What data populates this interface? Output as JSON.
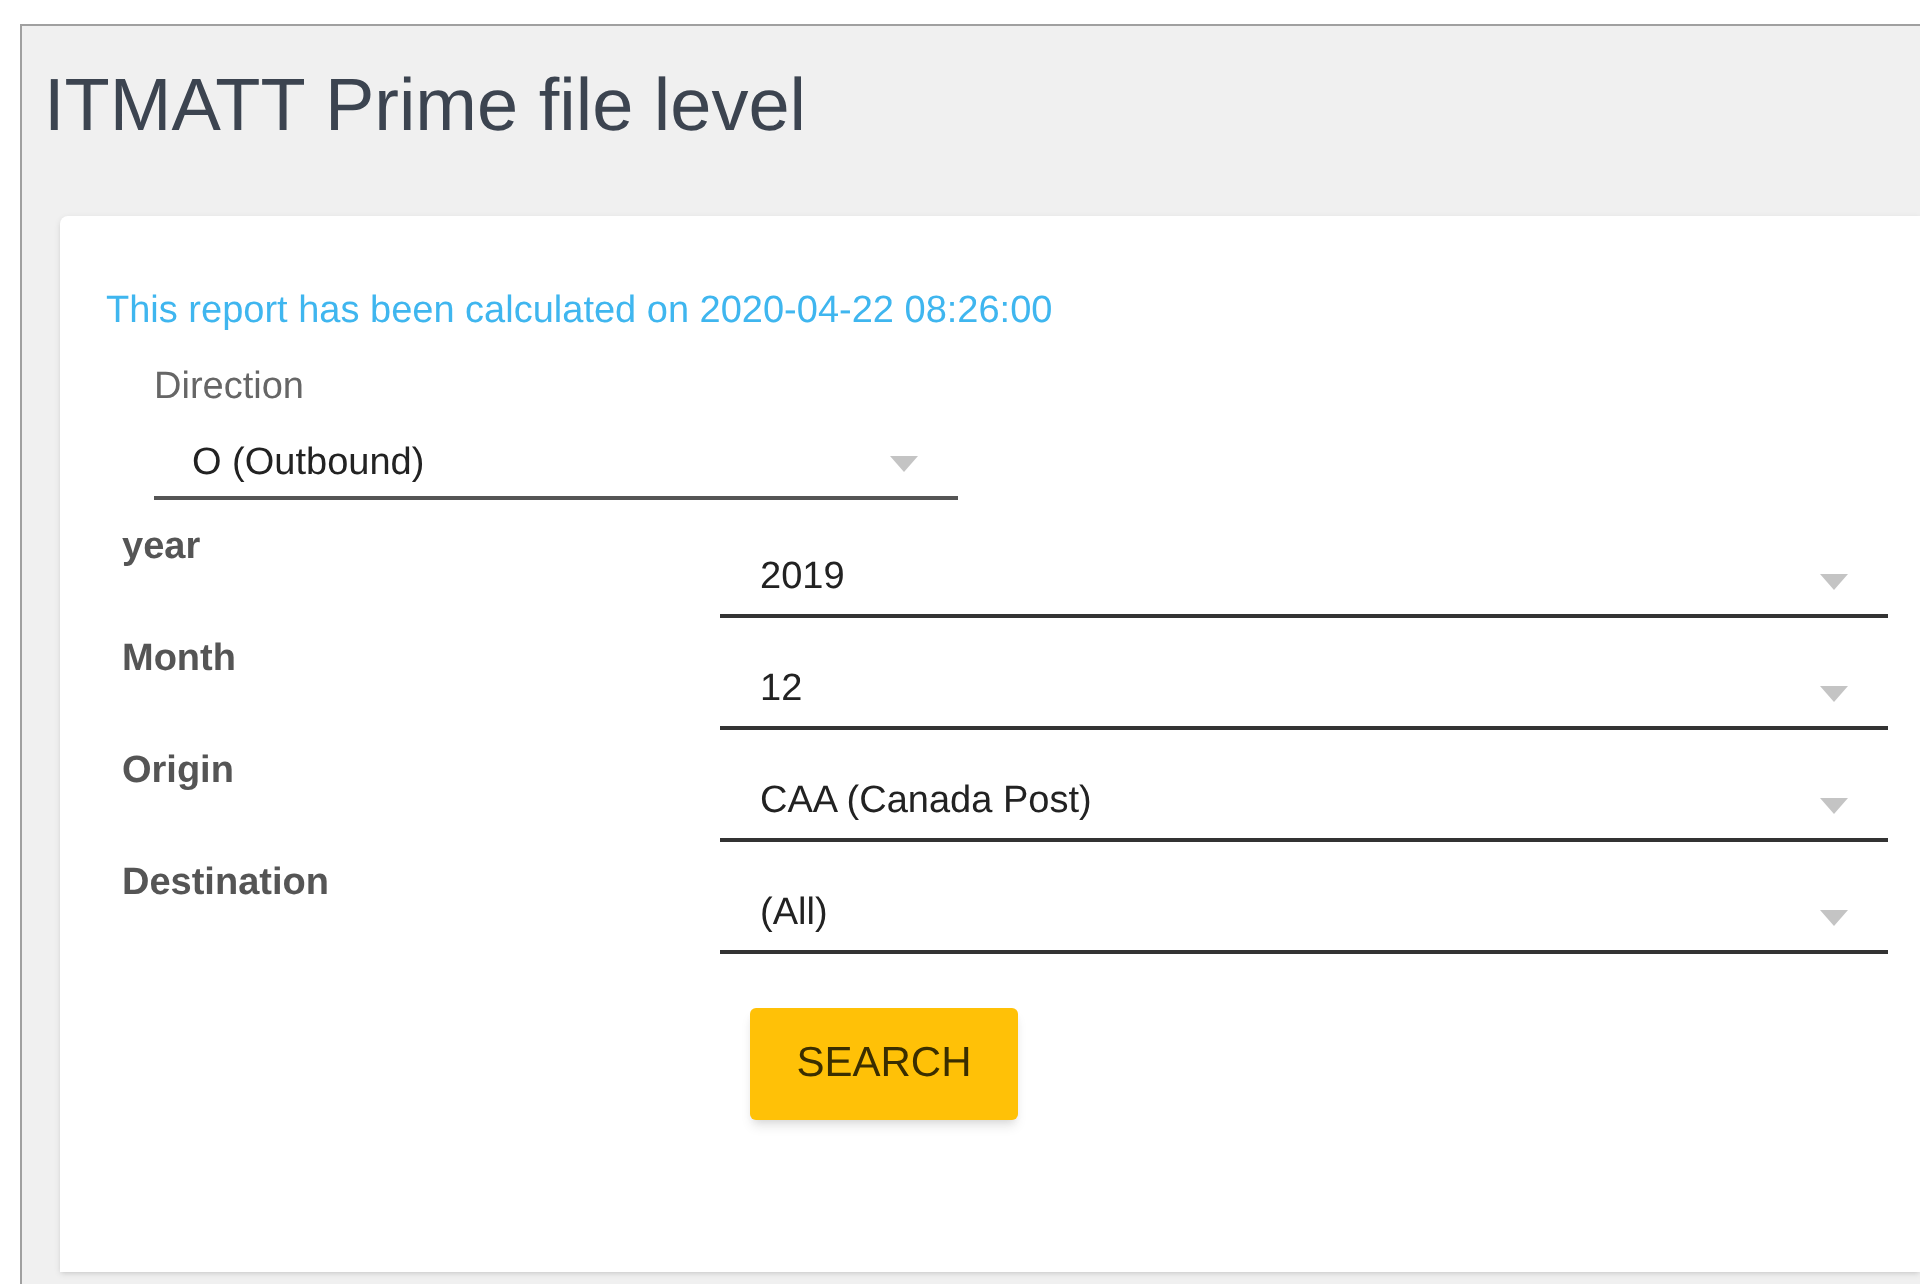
{
  "title": "ITMATT Prime file level",
  "info": "This report has been calculated on 2020-04-22 08:26:00",
  "direction": {
    "label": "Direction",
    "value": "O (Outbound)"
  },
  "filters": [
    {
      "label": "year",
      "value": "2019"
    },
    {
      "label": "Month",
      "value": "12"
    },
    {
      "label": "Origin",
      "value": "CAA (Canada Post)"
    },
    {
      "label": "Destination",
      "value": "(All)"
    }
  ],
  "search_button": "SEARCH"
}
